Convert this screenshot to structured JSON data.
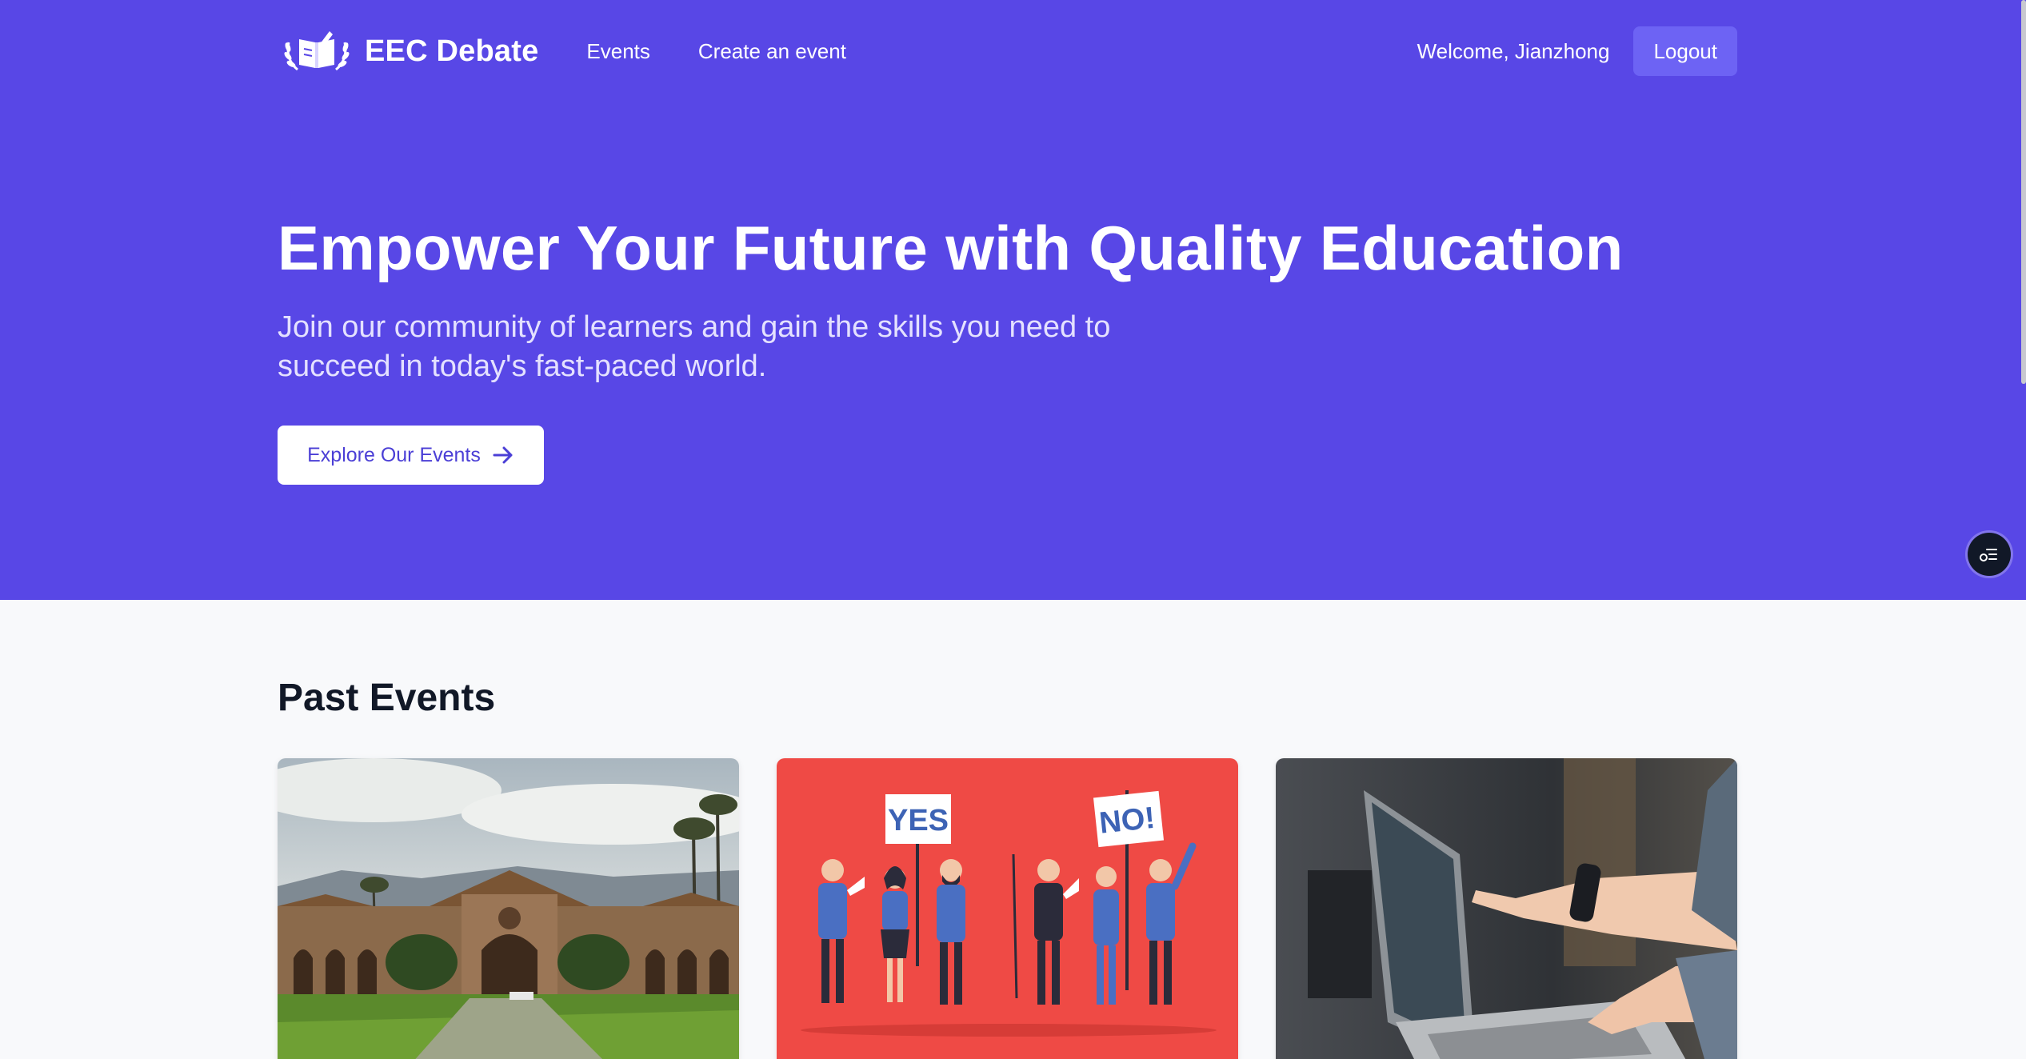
{
  "nav": {
    "brand": "EEC Debate",
    "links": [
      "Events",
      "Create an event"
    ],
    "welcome": "Welcome, Jianzhong",
    "logout_label": "Logout"
  },
  "hero": {
    "title": "Empower Your Future with Quality Education",
    "subtitle": "Join our community of learners and gain the skills you need to succeed in today's fast-paced world.",
    "cta_label": "Explore Our Events"
  },
  "past_events": {
    "title": "Past Events",
    "cards": [
      {
        "image": "campus-photo"
      },
      {
        "image": "debate-illustration",
        "signs": [
          "YES",
          "NO!"
        ]
      },
      {
        "image": "laptop-photo"
      }
    ]
  },
  "colors": {
    "hero_bg": "#5847e6",
    "logout_bg": "#6d63f4",
    "cta_text": "#4b3fd6",
    "page_bg": "#f8f9fb",
    "debate_card_bg": "#ef4a45"
  },
  "icons": [
    "brand-logo-icon",
    "arrow-right-icon",
    "menu-icon"
  ]
}
